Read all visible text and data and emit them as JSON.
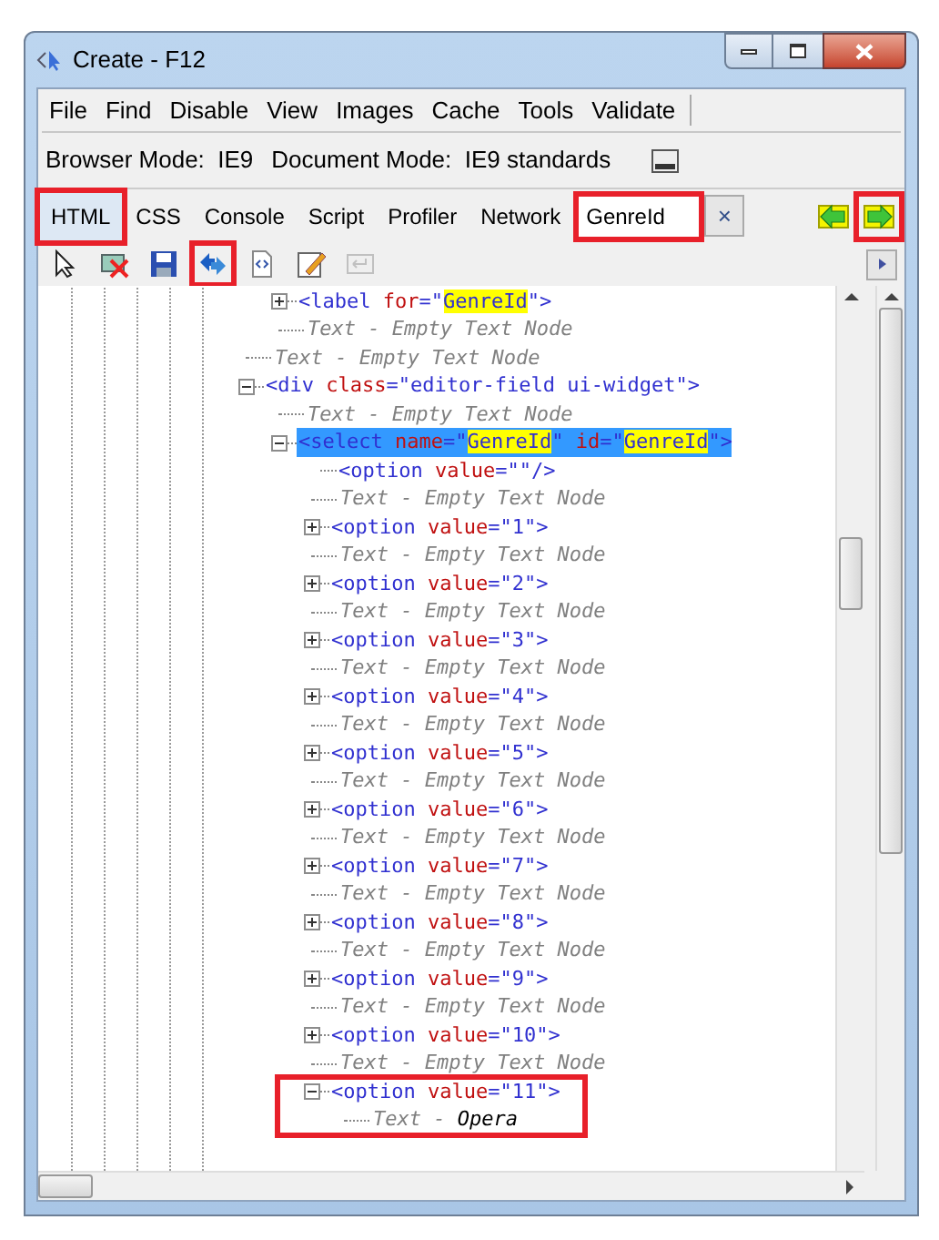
{
  "window": {
    "title": "Create - F12"
  },
  "menu": [
    "File",
    "Find",
    "Disable",
    "View",
    "Images",
    "Cache",
    "Tools",
    "Validate"
  ],
  "modes": [
    {
      "label": "Browser Mode:",
      "value": "IE9"
    },
    {
      "label": "Document Mode:",
      "value": "IE9 standards"
    }
  ],
  "tabs": [
    {
      "label": "HTML",
      "selected": true,
      "callout": true
    },
    {
      "label": "CSS",
      "selected": false,
      "callout": false
    },
    {
      "label": "Console",
      "selected": false,
      "callout": false
    },
    {
      "label": "Script",
      "selected": false,
      "callout": false
    },
    {
      "label": "Profiler",
      "selected": false,
      "callout": false
    },
    {
      "label": "Network",
      "selected": false,
      "callout": false
    }
  ],
  "search": {
    "value": "GenreId",
    "callout": true,
    "clear": "×"
  },
  "nav": [
    {
      "kind": "prev",
      "callout": false
    },
    {
      "kind": "next",
      "callout": true
    }
  ],
  "tools": [
    {
      "kind": "select",
      "callout": false,
      "disabled": false
    },
    {
      "kind": "clear",
      "callout": false,
      "disabled": false
    },
    {
      "kind": "save",
      "callout": false,
      "disabled": false
    },
    {
      "kind": "refresh",
      "callout": true,
      "disabled": false
    },
    {
      "kind": "source",
      "callout": false,
      "disabled": false
    },
    {
      "kind": "edit",
      "callout": false,
      "disabled": false
    },
    {
      "kind": "word-wrap",
      "callout": false,
      "disabled": true
    }
  ],
  "tree": [
    {
      "kind": "continued",
      "children": [
        {
          "kind": "element",
          "expanded": false,
          "selected": false,
          "callout": false,
          "parts": [
            {
              "kind": "tag",
              "s": "<label"
            },
            {
              "kind": "attr",
              "s": " for"
            },
            {
              "kind": "punct",
              "s": "=\""
            },
            {
              "kind": "match",
              "s": "GenreId"
            },
            {
              "kind": "punct",
              "s": "\">"
            }
          ]
        },
        {
          "kind": "text",
          "label": "Text - ",
          "value": "Empty Text Node",
          "empty": true
        }
      ]
    },
    {
      "kind": "text",
      "label": "Text - ",
      "value": "Empty Text Node",
      "empty": true
    },
    {
      "kind": "element",
      "expanded": true,
      "selected": false,
      "callout": false,
      "parts": [
        {
          "kind": "tag",
          "s": "<div"
        },
        {
          "kind": "attr",
          "s": " class"
        },
        {
          "kind": "punct",
          "s": "="
        },
        {
          "kind": "value",
          "s": "\"editor-field ui-widget\""
        },
        {
          "kind": "tag",
          "s": ">"
        }
      ],
      "children": [
        {
          "kind": "text",
          "label": "Text - ",
          "value": "Empty Text Node",
          "empty": true
        },
        {
          "kind": "element",
          "expanded": true,
          "selected": true,
          "callout": false,
          "parts": [
            {
              "kind": "tag",
              "s": "<select"
            },
            {
              "kind": "attr",
              "s": " name"
            },
            {
              "kind": "punct",
              "s": "=\""
            },
            {
              "kind": "match",
              "s": "GenreId"
            },
            {
              "kind": "punct",
              "s": "\""
            },
            {
              "kind": "attr",
              "s": " id"
            },
            {
              "kind": "punct",
              "s": "=\""
            },
            {
              "kind": "match",
              "s": "GenreId"
            },
            {
              "kind": "punct",
              "s": "\">"
            }
          ],
          "children": [
            {
              "kind": "leaf",
              "selected": false,
              "callout": false,
              "parts": [
                {
                  "kind": "tag",
                  "s": "<option"
                },
                {
                  "kind": "attr",
                  "s": " value"
                },
                {
                  "kind": "punct",
                  "s": "="
                },
                {
                  "kind": "value",
                  "s": "\"\"/>"
                }
              ]
            },
            {
              "kind": "text",
              "label": "Text - ",
              "value": "Empty Text Node",
              "empty": true
            },
            {
              "kind": "element",
              "expanded": false,
              "selected": false,
              "callout": false,
              "parts": [
                {
                  "kind": "tag",
                  "s": "<option"
                },
                {
                  "kind": "attr",
                  "s": " value"
                },
                {
                  "kind": "punct",
                  "s": "="
                },
                {
                  "kind": "value",
                  "s": "\"1\">"
                }
              ]
            },
            {
              "kind": "text",
              "label": "Text - ",
              "value": "Empty Text Node",
              "empty": true
            },
            {
              "kind": "element",
              "expanded": false,
              "selected": false,
              "callout": false,
              "parts": [
                {
                  "kind": "tag",
                  "s": "<option"
                },
                {
                  "kind": "attr",
                  "s": " value"
                },
                {
                  "kind": "punct",
                  "s": "="
                },
                {
                  "kind": "value",
                  "s": "\"2\">"
                }
              ]
            },
            {
              "kind": "text",
              "label": "Text - ",
              "value": "Empty Text Node",
              "empty": true
            },
            {
              "kind": "element",
              "expanded": false,
              "selected": false,
              "callout": false,
              "parts": [
                {
                  "kind": "tag",
                  "s": "<option"
                },
                {
                  "kind": "attr",
                  "s": " value"
                },
                {
                  "kind": "punct",
                  "s": "="
                },
                {
                  "kind": "value",
                  "s": "\"3\">"
                }
              ]
            },
            {
              "kind": "text",
              "label": "Text - ",
              "value": "Empty Text Node",
              "empty": true
            },
            {
              "kind": "element",
              "expanded": false,
              "selected": false,
              "callout": false,
              "parts": [
                {
                  "kind": "tag",
                  "s": "<option"
                },
                {
                  "kind": "attr",
                  "s": " value"
                },
                {
                  "kind": "punct",
                  "s": "="
                },
                {
                  "kind": "value",
                  "s": "\"4\">"
                }
              ]
            },
            {
              "kind": "text",
              "label": "Text - ",
              "value": "Empty Text Node",
              "empty": true
            },
            {
              "kind": "element",
              "expanded": false,
              "selected": false,
              "callout": false,
              "parts": [
                {
                  "kind": "tag",
                  "s": "<option"
                },
                {
                  "kind": "attr",
                  "s": " value"
                },
                {
                  "kind": "punct",
                  "s": "="
                },
                {
                  "kind": "value",
                  "s": "\"5\">"
                }
              ]
            },
            {
              "kind": "text",
              "label": "Text - ",
              "value": "Empty Text Node",
              "empty": true
            },
            {
              "kind": "element",
              "expanded": false,
              "selected": false,
              "callout": false,
              "parts": [
                {
                  "kind": "tag",
                  "s": "<option"
                },
                {
                  "kind": "attr",
                  "s": " value"
                },
                {
                  "kind": "punct",
                  "s": "="
                },
                {
                  "kind": "value",
                  "s": "\"6\">"
                }
              ]
            },
            {
              "kind": "text",
              "label": "Text - ",
              "value": "Empty Text Node",
              "empty": true
            },
            {
              "kind": "element",
              "expanded": false,
              "selected": false,
              "callout": false,
              "parts": [
                {
                  "kind": "tag",
                  "s": "<option"
                },
                {
                  "kind": "attr",
                  "s": " value"
                },
                {
                  "kind": "punct",
                  "s": "="
                },
                {
                  "kind": "value",
                  "s": "\"7\">"
                }
              ]
            },
            {
              "kind": "text",
              "label": "Text - ",
              "value": "Empty Text Node",
              "empty": true
            },
            {
              "kind": "element",
              "expanded": false,
              "selected": false,
              "callout": false,
              "parts": [
                {
                  "kind": "tag",
                  "s": "<option"
                },
                {
                  "kind": "attr",
                  "s": " value"
                },
                {
                  "kind": "punct",
                  "s": "="
                },
                {
                  "kind": "value",
                  "s": "\"8\">"
                }
              ]
            },
            {
              "kind": "text",
              "label": "Text - ",
              "value": "Empty Text Node",
              "empty": true
            },
            {
              "kind": "element",
              "expanded": false,
              "selected": false,
              "callout": false,
              "parts": [
                {
                  "kind": "tag",
                  "s": "<option"
                },
                {
                  "kind": "attr",
                  "s": " value"
                },
                {
                  "kind": "punct",
                  "s": "="
                },
                {
                  "kind": "value",
                  "s": "\"9\">"
                }
              ]
            },
            {
              "kind": "text",
              "label": "Text - ",
              "value": "Empty Text Node",
              "empty": true
            },
            {
              "kind": "element",
              "expanded": false,
              "selected": false,
              "callout": false,
              "parts": [
                {
                  "kind": "tag",
                  "s": "<option"
                },
                {
                  "kind": "attr",
                  "s": " value"
                },
                {
                  "kind": "punct",
                  "s": "="
                },
                {
                  "kind": "value",
                  "s": "\"10\">"
                }
              ]
            },
            {
              "kind": "text",
              "label": "Text - ",
              "value": "Empty Text Node",
              "empty": true
            },
            {
              "kind": "element",
              "expanded": true,
              "selected": false,
              "callout": true,
              "parts": [
                {
                  "kind": "tag",
                  "s": "<option"
                },
                {
                  "kind": "attr",
                  "s": " value"
                },
                {
                  "kind": "punct",
                  "s": "="
                },
                {
                  "kind": "value",
                  "s": "\"11\">"
                }
              ],
              "children": [
                {
                  "kind": "text",
                  "label": "Text - ",
                  "value": "Opera",
                  "empty": false
                }
              ]
            }
          ]
        }
      ]
    }
  ]
}
